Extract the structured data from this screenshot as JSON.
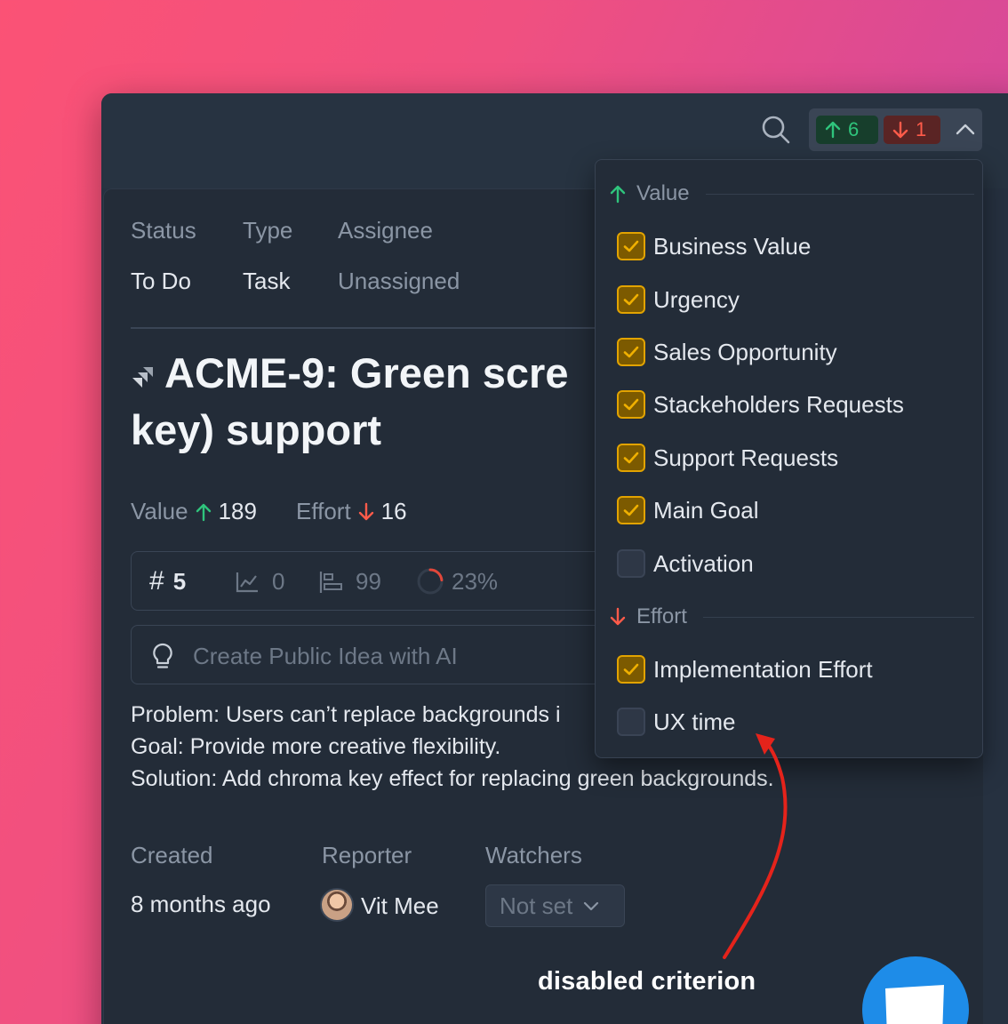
{
  "header": {
    "value_count": "6",
    "effort_count": "1"
  },
  "fields": {
    "status_label": "Status",
    "status_value": "To Do",
    "type_label": "Type",
    "type_value": "Task",
    "assignee_label": "Assignee",
    "assignee_value": "Unassigned"
  },
  "issue": {
    "title_line1": "ACME-9: Green scre",
    "title_line2": "key) support"
  },
  "scores": {
    "value_label": "Value",
    "value_score": "189",
    "effort_label": "Effort",
    "effort_score": "16"
  },
  "metrics": {
    "rank": "5",
    "trend": "0",
    "score": "99",
    "progress": "23%",
    "progress_fraction": 0.23
  },
  "idea": {
    "placeholder": "Create Public Idea with AI"
  },
  "description": {
    "line1": "Problem: Users can’t replace backgrounds i",
    "line2": "Goal: Provide more creative flexibility.",
    "line3": "Solution: Add chroma key effect for replacing green backgrounds."
  },
  "meta": {
    "created_label": "Created",
    "created_value": "8 months ago",
    "reporter_label": "Reporter",
    "reporter_name": "Vit Mee",
    "watchers_label": "Watchers",
    "watchers_value": "Not set"
  },
  "dropdown": {
    "value_group": "Value",
    "effort_group": "Effort",
    "value_items": [
      {
        "label": "Business Value",
        "checked": true
      },
      {
        "label": "Urgency",
        "checked": true
      },
      {
        "label": "Sales Opportunity",
        "checked": true
      },
      {
        "label": "Stackeholders Requests",
        "checked": true
      },
      {
        "label": "Support Requests",
        "checked": true
      },
      {
        "label": "Main Goal",
        "checked": true
      },
      {
        "label": "Activation",
        "checked": false
      }
    ],
    "effort_items": [
      {
        "label": "Implementation Effort",
        "checked": true
      },
      {
        "label": "UX time",
        "checked": false
      }
    ]
  },
  "annotation": {
    "text": "disabled criterion"
  },
  "colors": {
    "up_green": "#2fc47c",
    "down_red": "#ff5b4a",
    "check_amber": "#e2a300",
    "arrow_red": "#e5231b"
  }
}
